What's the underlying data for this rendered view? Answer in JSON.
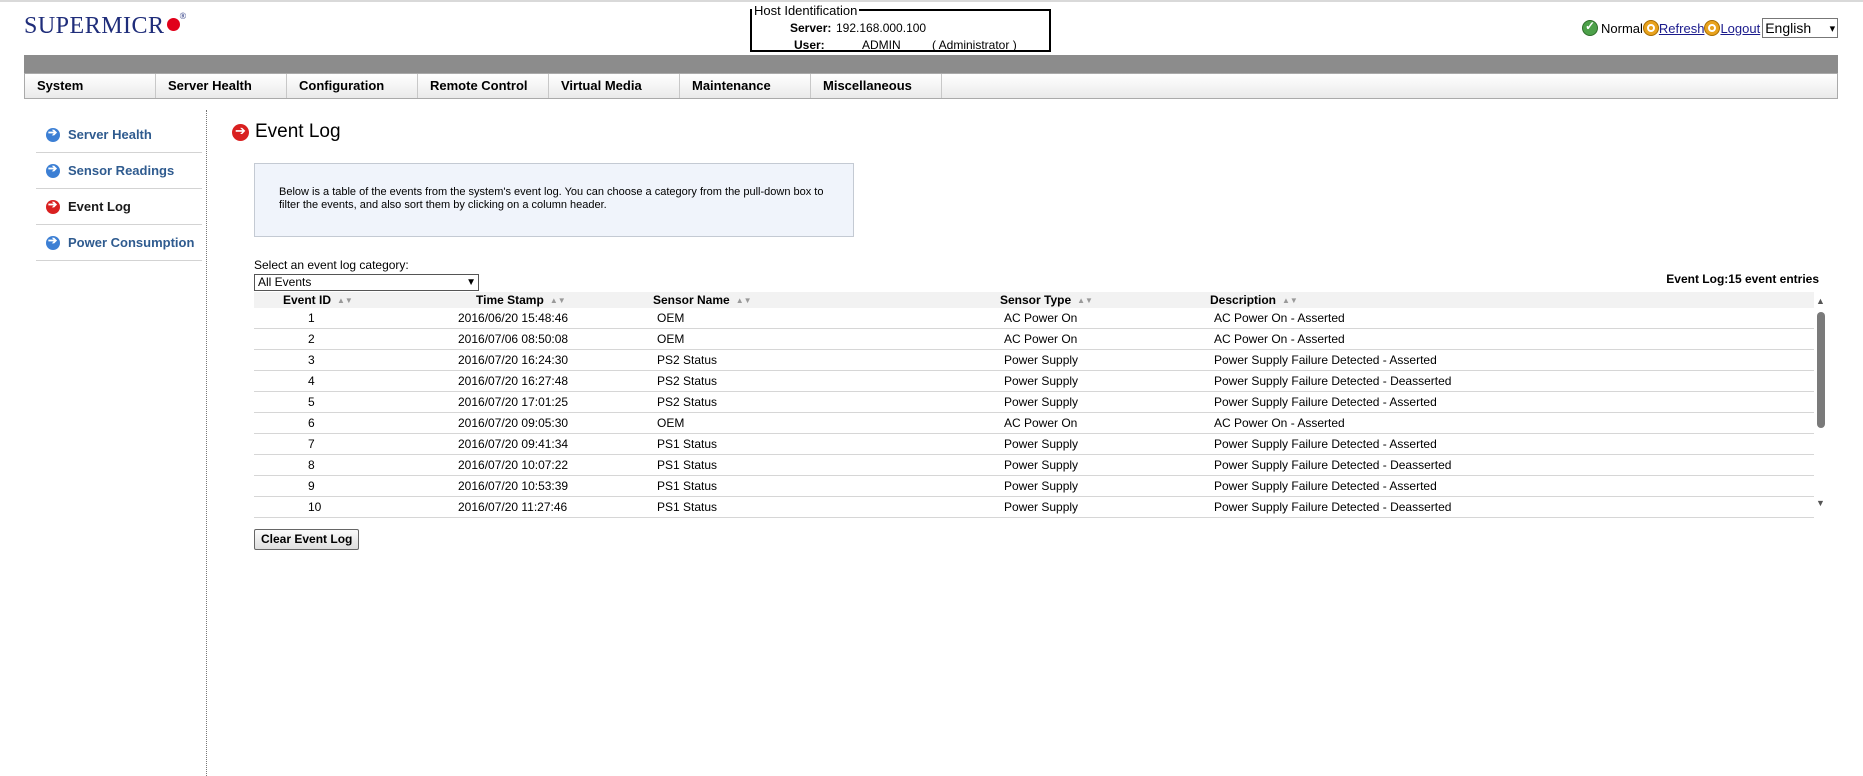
{
  "brand": {
    "logo_text": "SUPERMICR"
  },
  "host": {
    "legend": "Host Identification",
    "server_label": "Server:",
    "server_value": "192.168.000.100",
    "user_label": "User:",
    "user_value": "ADMIN",
    "user_role": "( Administrator )"
  },
  "status": {
    "state": "Normal",
    "refresh": "Refresh",
    "logout": "Logout",
    "language": "English",
    "ok_color": "#4da14a",
    "action_color": "#e8a21d"
  },
  "menu": [
    "System",
    "Server Health",
    "Configuration",
    "Remote Control",
    "Virtual Media",
    "Maintenance",
    "Miscellaneous"
  ],
  "sidebar": {
    "items": [
      {
        "label": "Server Health",
        "icon": "arrow-right-blue-icon"
      },
      {
        "label": "Sensor Readings",
        "icon": "arrow-right-blue-icon"
      },
      {
        "label": "Event Log",
        "icon": "arrow-right-red-icon"
      },
      {
        "label": "Power Consumption",
        "icon": "arrow-right-blue-icon"
      }
    ],
    "active_color": "#d92020",
    "link_color": "#2f5b8f"
  },
  "page": {
    "title": "Event Log",
    "info": "Below is a table of the events from the system's event log. You can choose a category from the pull-down box to filter the events, and also sort them by clicking on a column header.",
    "category_label": "Select an event log category:",
    "category_selected": "All Events",
    "entries_summary": "Event Log:15 event entries",
    "clear_button": "Clear Event Log"
  },
  "table": {
    "columns": [
      "Event ID",
      "Time Stamp",
      "Sensor Name",
      "Sensor Type",
      "Description"
    ],
    "rows": [
      [
        "1",
        "2016/06/20 15:48:46",
        "OEM",
        "AC Power On",
        "AC Power On - Asserted"
      ],
      [
        "2",
        "2016/07/06 08:50:08",
        "OEM",
        "AC Power On",
        "AC Power On - Asserted"
      ],
      [
        "3",
        "2016/07/20 16:24:30",
        "PS2 Status",
        "Power Supply",
        "Power Supply Failure Detected - Asserted"
      ],
      [
        "4",
        "2016/07/20 16:27:48",
        "PS2 Status",
        "Power Supply",
        "Power Supply Failure Detected - Deasserted"
      ],
      [
        "5",
        "2016/07/20 17:01:25",
        "PS2 Status",
        "Power Supply",
        "Power Supply Failure Detected - Asserted"
      ],
      [
        "6",
        "2016/07/20 09:05:30",
        "OEM",
        "AC Power On",
        "AC Power On - Asserted"
      ],
      [
        "7",
        "2016/07/20 09:41:34",
        "PS1 Status",
        "Power Supply",
        "Power Supply Failure Detected - Asserted"
      ],
      [
        "8",
        "2016/07/20 10:07:22",
        "PS1 Status",
        "Power Supply",
        "Power Supply Failure Detected - Deasserted"
      ],
      [
        "9",
        "2016/07/20 10:53:39",
        "PS1 Status",
        "Power Supply",
        "Power Supply Failure Detected - Asserted"
      ],
      [
        "10",
        "2016/07/20 11:27:46",
        "PS1 Status",
        "Power Supply",
        "Power Supply Failure Detected - Deasserted"
      ]
    ]
  }
}
